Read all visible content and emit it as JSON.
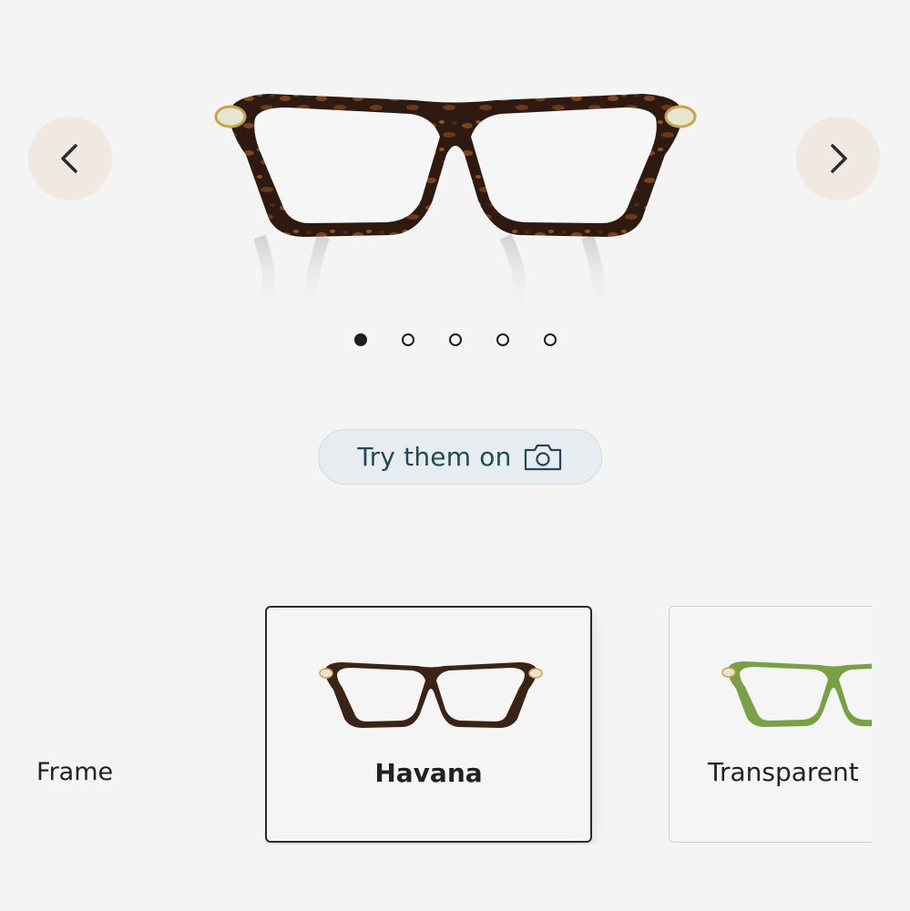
{
  "carousel": {
    "prev_icon": "chevron-left-icon",
    "next_icon": "chevron-right-icon",
    "total_slides": 5,
    "active_slide": 1
  },
  "try_on": {
    "label": "Try them on",
    "icon": "camera-icon"
  },
  "frame": {
    "label": "Frame",
    "options": [
      {
        "name": "Havana",
        "selected": true,
        "color": "#3b2416"
      },
      {
        "name": "Transparent",
        "selected": false,
        "color": "#7aa046"
      }
    ]
  }
}
